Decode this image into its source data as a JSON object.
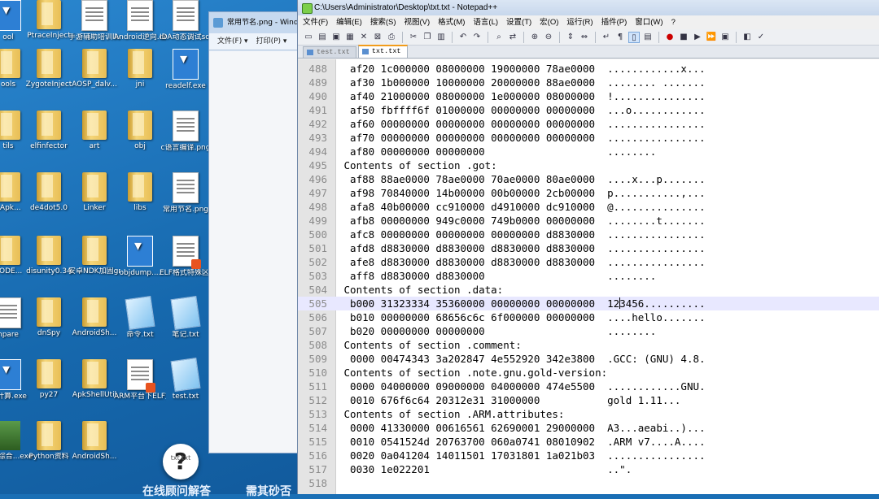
{
  "desktop": {
    "icons": [
      {
        "label": "ool",
        "kind": "exe"
      },
      {
        "label": "PtraceInject",
        "kind": "folder"
      },
      {
        "label": "手游辅助培训ll.docx",
        "kind": "file"
      },
      {
        "label": "Android逆向.docx",
        "kind": "file"
      },
      {
        "label": "IDA动态调试so完全秘...",
        "kind": "file"
      },
      {
        "label": "ools",
        "kind": "folder"
      },
      {
        "label": "ZygoteInject",
        "kind": "folder"
      },
      {
        "label": "AOSP_dalv...",
        "kind": "folder"
      },
      {
        "label": "jni",
        "kind": "folder"
      },
      {
        "label": "readelf.exe",
        "kind": "exe"
      },
      {
        "label": "tils",
        "kind": "folder"
      },
      {
        "label": "elfinfector",
        "kind": "folder"
      },
      {
        "label": "art",
        "kind": "folder"
      },
      {
        "label": "obj",
        "kind": "folder"
      },
      {
        "label": "c语言编译.png",
        "kind": "file"
      },
      {
        "label": "aApk...",
        "kind": "folder"
      },
      {
        "label": "de4dot5.0",
        "kind": "folder"
      },
      {
        "label": "Linker",
        "kind": "folder"
      },
      {
        "label": "libs",
        "kind": "folder"
      },
      {
        "label": "常用节名.png",
        "kind": "file"
      },
      {
        "label": "CODE...",
        "kind": "folder"
      },
      {
        "label": "disunity0.34",
        "kind": "folder"
      },
      {
        "label": "安卓NDK加固gradle...",
        "kind": "folder"
      },
      {
        "label": "objdump....",
        "kind": "exe"
      },
      {
        "label": "ELF格式特殊区段讲解.pdf",
        "kind": "pdf"
      },
      {
        "label": "npare",
        "kind": "file"
      },
      {
        "label": "dnSpy",
        "kind": "folder"
      },
      {
        "label": "AndroidSh...",
        "kind": "folder"
      },
      {
        "label": "命令.txt",
        "kind": "txt"
      },
      {
        "label": "笔记.txt",
        "kind": "txt"
      },
      {
        "label": "数计算.exe",
        "kind": "exe"
      },
      {
        "label": "py27",
        "kind": "folder"
      },
      {
        "label": "ApkShellUtil",
        "kind": "folder"
      },
      {
        "label": "ARM平台下ELF文件反...",
        "kind": "pdf"
      },
      {
        "label": "test.txt",
        "kind": "txt"
      },
      {
        "label": "服密综合...exe",
        "kind": "green"
      },
      {
        "label": "Python资料",
        "kind": "folder"
      },
      {
        "label": "AndroidSh...",
        "kind": "folder"
      }
    ],
    "bubble_label": "txt.txt",
    "overlay_left": "在线顾问解答",
    "overlay_right": "需其砂否"
  },
  "paint_window": {
    "title": "常用节名.png - Windows 照片查看器",
    "menu": [
      "文件(F) ▾",
      "打印(P) ▾"
    ]
  },
  "notepad": {
    "title": "C:\\Users\\Administrator\\Desktop\\txt.txt - Notepad++",
    "menu": [
      "文件(F)",
      "编辑(E)",
      "搜索(S)",
      "视图(V)",
      "格式(M)",
      "语言(L)",
      "设置(T)",
      "宏(O)",
      "运行(R)",
      "插件(P)",
      "窗口(W)",
      "?"
    ],
    "tabs": [
      {
        "label": "test.txt",
        "selected": false
      },
      {
        "label": "txt.txt",
        "selected": true
      }
    ],
    "current_line": 505,
    "lines": [
      {
        "n": "488",
        "t": "  af20 1c000000 08000000 19000000 78ae0000  ............x..."
      },
      {
        "n": "489",
        "t": "  af30 1b000000 10000000 20000000 88ae0000  ........ ......."
      },
      {
        "n": "490",
        "t": "  af40 21000000 08000000 1e000000 08000000  !..............."
      },
      {
        "n": "491",
        "t": "  af50 fbffff6f 01000000 00000000 00000000  ...o............"
      },
      {
        "n": "492",
        "t": "  af60 00000000 00000000 00000000 00000000  ................"
      },
      {
        "n": "493",
        "t": "  af70 00000000 00000000 00000000 00000000  ................"
      },
      {
        "n": "494",
        "t": "  af80 00000000 00000000                    ........"
      },
      {
        "n": "495",
        "t": " Contents of section .got:"
      },
      {
        "n": "496",
        "t": "  af88 88ae0000 78ae0000 70ae0000 80ae0000  ....x...p......."
      },
      {
        "n": "497",
        "t": "  af98 70840000 14b00000 00b00000 2cb00000  p...........,..."
      },
      {
        "n": "498",
        "t": "  afa8 40b00000 cc910000 d4910000 dc910000  @..............."
      },
      {
        "n": "499",
        "t": "  afb8 00000000 949c0000 749b0000 00000000  ........t......."
      },
      {
        "n": "500",
        "t": "  afc8 00000000 00000000 00000000 d8830000  ................"
      },
      {
        "n": "501",
        "t": "  afd8 d8830000 d8830000 d8830000 d8830000  ................"
      },
      {
        "n": "502",
        "t": "  afe8 d8830000 d8830000 d8830000 d8830000  ................"
      },
      {
        "n": "503",
        "t": "  aff8 d8830000 d8830000                    ........"
      },
      {
        "n": "504",
        "t": " Contents of section .data:"
      },
      {
        "n": "505",
        "t": "  b000 31323334 35360000 00000000 00000000  123456.........."
      },
      {
        "n": "506",
        "t": "  b010 00000000 68656c6c 6f000000 00000000  ....hello......."
      },
      {
        "n": "507",
        "t": "  b020 00000000 00000000                    ........"
      },
      {
        "n": "508",
        "t": " Contents of section .comment:"
      },
      {
        "n": "509",
        "t": "  0000 00474343 3a202847 4e552920 342e3800  .GCC: (GNU) 4.8."
      },
      {
        "n": "510",
        "t": " Contents of section .note.gnu.gold-version:"
      },
      {
        "n": "511",
        "t": "  0000 04000000 09000000 04000000 474e5500  ............GNU."
      },
      {
        "n": "512",
        "t": "  0010 676f6c64 20312e31 31000000           gold 1.11..."
      },
      {
        "n": "513",
        "t": " Contents of section .ARM.attributes:"
      },
      {
        "n": "514",
        "t": "  0000 41330000 00616561 62690001 29000000  A3...aeabi..)..."
      },
      {
        "n": "515",
        "t": "  0010 0541524d 20763700 060a0741 08010902  .ARM v7....A...."
      },
      {
        "n": "516",
        "t": "  0020 0a041204 14011501 17031801 1a021b03  ................"
      },
      {
        "n": "517",
        "t": "  0030 1e022201                             ..\"."
      },
      {
        "n": "518",
        "t": ""
      }
    ]
  }
}
